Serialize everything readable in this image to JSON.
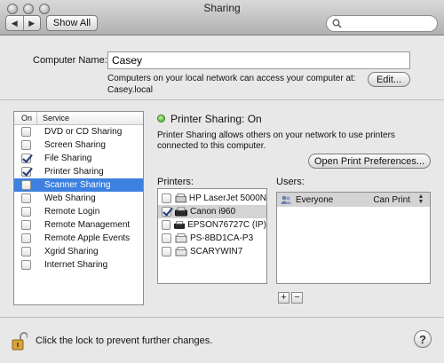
{
  "window": {
    "title": "Sharing"
  },
  "toolbar": {
    "back_icon": "left-arrow-icon",
    "forward_icon": "right-arrow-icon",
    "show_all_label": "Show All",
    "search": {
      "value": "",
      "placeholder": ""
    }
  },
  "computer_name": {
    "label": "Computer Name:",
    "value": "Casey",
    "info_line1": "Computers on your local network can access your computer at:",
    "info_line2": "Casey.local",
    "edit_label": "Edit..."
  },
  "services": {
    "header_on": "On",
    "header_service": "Service",
    "selected_index": 4,
    "items": [
      {
        "label": "DVD or CD Sharing",
        "checked": false
      },
      {
        "label": "Screen Sharing",
        "checked": false
      },
      {
        "label": "File Sharing",
        "checked": true
      },
      {
        "label": "Printer Sharing",
        "checked": true
      },
      {
        "label": "Scanner Sharing",
        "checked": false
      },
      {
        "label": "Web Sharing",
        "checked": false
      },
      {
        "label": "Remote Login",
        "checked": false
      },
      {
        "label": "Remote Management",
        "checked": false
      },
      {
        "label": "Remote Apple Events",
        "checked": false
      },
      {
        "label": "Xgrid Sharing",
        "checked": false
      },
      {
        "label": "Internet Sharing",
        "checked": false
      }
    ]
  },
  "detail": {
    "status": "Printer Sharing: On",
    "status_color": "#3fa81c",
    "description": "Printer Sharing allows others on your network to use printers connected to this computer.",
    "open_prefs_label": "Open Print Preferences...",
    "printers_label": "Printers:",
    "users_label": "Users:",
    "printers": [
      {
        "name": "HP LaserJet 5000N",
        "checked": false,
        "icon": "laser-printer-icon"
      },
      {
        "name": "Canon i960",
        "checked": true,
        "icon": "inkjet-printer-icon"
      },
      {
        "name": "EPSON76727C (IP)",
        "checked": false,
        "icon": "inkjet-printer-icon"
      },
      {
        "name": "PS-8BD1CA-P3",
        "checked": false,
        "icon": "printer-icon"
      },
      {
        "name": "SCARYWIN7",
        "checked": false,
        "icon": "printer-icon"
      }
    ],
    "users": [
      {
        "name": "Everyone",
        "permission": "Can Print",
        "icon": "group-icon"
      }
    ],
    "add_label": "+",
    "remove_label": "−"
  },
  "footer": {
    "lock_text": "Click the lock to prevent further changes.",
    "help_label": "?"
  },
  "colors": {
    "selection": "#3d80df",
    "window_bg": "#e8e8e8"
  }
}
